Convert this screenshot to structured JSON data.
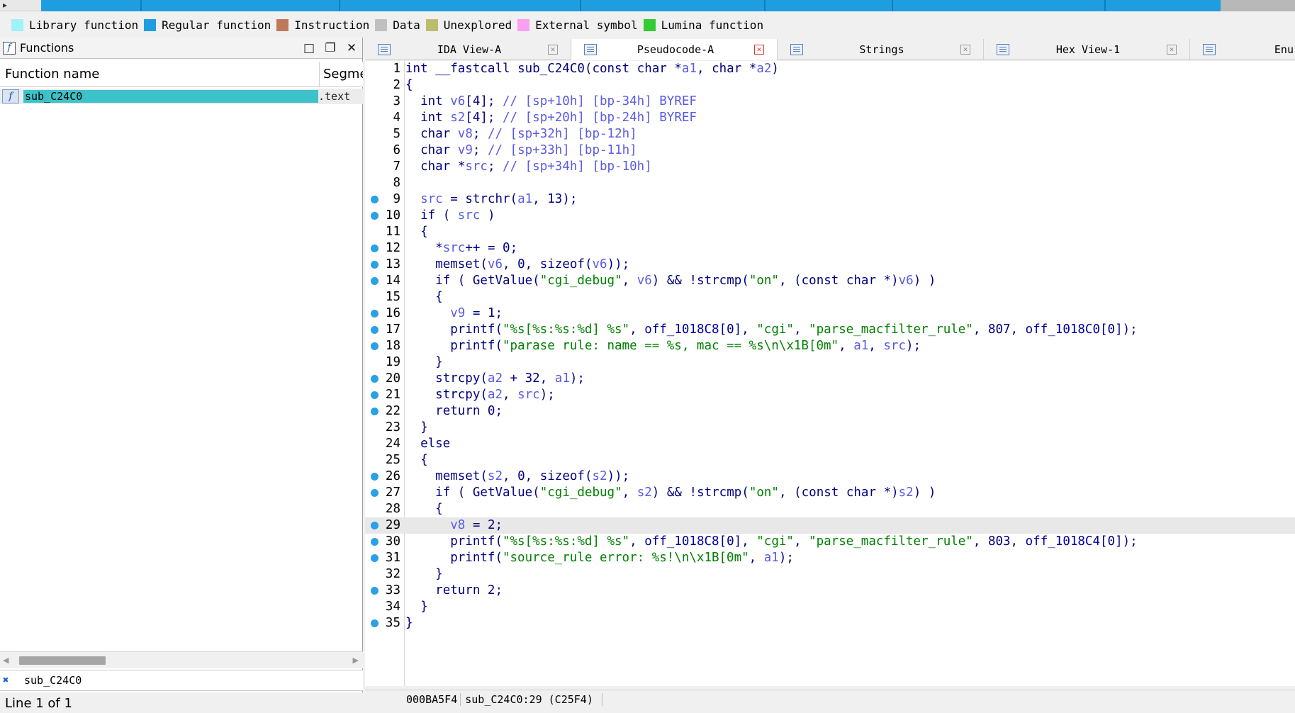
{
  "legend": [
    {
      "label": "Library function",
      "color": "#9ff2f7"
    },
    {
      "label": "Regular function",
      "color": "#1e9ee0"
    },
    {
      "label": "Instruction",
      "color": "#bd7a5a"
    },
    {
      "label": "Data",
      "color": "#c0c0c0"
    },
    {
      "label": "Unexplored",
      "color": "#bcbc6e"
    },
    {
      "label": "External symbol",
      "color": "#fb9ff2"
    },
    {
      "label": "Lumina function",
      "color": "#33cc33"
    }
  ],
  "functions_pane": {
    "title": "Functions",
    "col_name": "Function name",
    "col_segment": "Segme",
    "rows": [
      {
        "name": "sub_C24C0",
        "segment": ".text"
      }
    ],
    "search_value": "sub_C24C0",
    "status": "Line 1 of 1"
  },
  "tabs": [
    {
      "label": "IDA View-A",
      "active": false
    },
    {
      "label": "Pseudocode-A",
      "active": true
    },
    {
      "label": "Strings",
      "active": false
    },
    {
      "label": "Hex View-1",
      "active": false
    },
    {
      "label": "Enu",
      "active": false
    }
  ],
  "code_lines": [
    {
      "n": "1",
      "bp": false,
      "html": "int __fastcall sub_C24C0(const char *a1, char *a2)"
    },
    {
      "n": "2",
      "bp": false,
      "html": "{"
    },
    {
      "n": "3",
      "bp": false,
      "html": "  int v6[4]; // [sp+10h] [bp-34h] BYREF"
    },
    {
      "n": "4",
      "bp": false,
      "html": "  int s2[4]; // [sp+20h] [bp-24h] BYREF"
    },
    {
      "n": "5",
      "bp": false,
      "html": "  char v8; // [sp+32h] [bp-12h]"
    },
    {
      "n": "6",
      "bp": false,
      "html": "  char v9; // [sp+33h] [bp-11h]"
    },
    {
      "n": "7",
      "bp": false,
      "html": "  char *src; // [sp+34h] [bp-10h]"
    },
    {
      "n": "8",
      "bp": false,
      "html": ""
    },
    {
      "n": "9",
      "bp": true,
      "html": "  src = strchr(a1, 13);"
    },
    {
      "n": "10",
      "bp": true,
      "html": "  if ( src )"
    },
    {
      "n": "11",
      "bp": false,
      "html": "  {"
    },
    {
      "n": "12",
      "bp": true,
      "html": "    *src++ = 0;"
    },
    {
      "n": "13",
      "bp": true,
      "html": "    memset(v6, 0, sizeof(v6));"
    },
    {
      "n": "14",
      "bp": true,
      "html": "    if ( GetValue(\"cgi_debug\", v6) && !strcmp(\"on\", (const char *)v6) )"
    },
    {
      "n": "15",
      "bp": false,
      "html": "    {"
    },
    {
      "n": "16",
      "bp": true,
      "html": "      v9 = 1;"
    },
    {
      "n": "17",
      "bp": true,
      "html": "      printf(\"%s[%s:%s:%d] %s\", off_1018C8[0], \"cgi\", \"parse_macfilter_rule\", 807, off_1018C0[0]);"
    },
    {
      "n": "18",
      "bp": true,
      "html": "      printf(\"parase rule: name == %s, mac == %s\\n\\x1B[0m\", a1, src);"
    },
    {
      "n": "19",
      "bp": false,
      "html": "    }"
    },
    {
      "n": "20",
      "bp": true,
      "html": "    strcpy(a2 + 32, a1);"
    },
    {
      "n": "21",
      "bp": true,
      "html": "    strcpy(a2, src);"
    },
    {
      "n": "22",
      "bp": true,
      "html": "    return 0;"
    },
    {
      "n": "23",
      "bp": false,
      "html": "  }"
    },
    {
      "n": "24",
      "bp": false,
      "html": "  else"
    },
    {
      "n": "25",
      "bp": false,
      "html": "  {"
    },
    {
      "n": "26",
      "bp": true,
      "html": "    memset(s2, 0, sizeof(s2));"
    },
    {
      "n": "27",
      "bp": true,
      "html": "    if ( GetValue(\"cgi_debug\", s2) && !strcmp(\"on\", (const char *)s2) )"
    },
    {
      "n": "28",
      "bp": false,
      "html": "    {"
    },
    {
      "n": "29",
      "bp": true,
      "html": "      v8 = 2;",
      "current": true
    },
    {
      "n": "30",
      "bp": true,
      "html": "      printf(\"%s[%s:%s:%d] %s\", off_1018C8[0], \"cgi\", \"parse_macfilter_rule\", 803, off_1018C4[0]);"
    },
    {
      "n": "31",
      "bp": true,
      "html": "      printf(\"source_rule error: %s!\\n\\x1B[0m\", a1);"
    },
    {
      "n": "32",
      "bp": false,
      "html": "    }"
    },
    {
      "n": "33",
      "bp": true,
      "html": "    return 2;"
    },
    {
      "n": "34",
      "bp": false,
      "html": "  }"
    },
    {
      "n": "35",
      "bp": true,
      "html": "}"
    }
  ],
  "editor_status": {
    "address": "000BA5F4",
    "location": "sub_C24C0:29 (C25F4)"
  }
}
